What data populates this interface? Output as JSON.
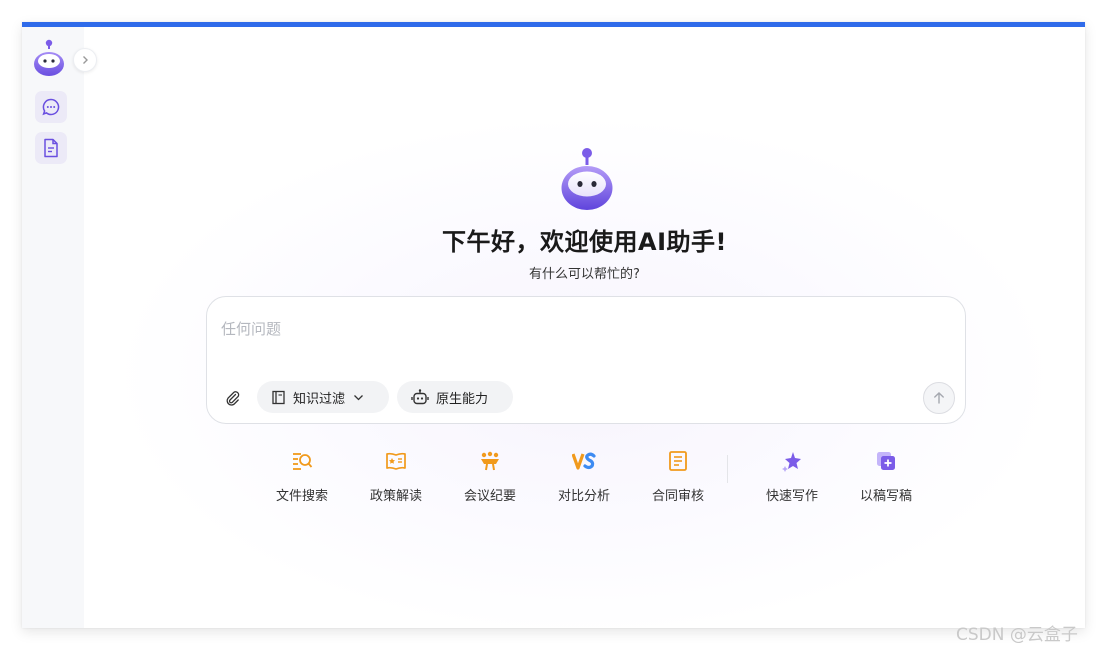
{
  "sidebar": {
    "logo_icon": "robot-mascot-icon",
    "expand_icon": "chevron-right-icon",
    "items": [
      {
        "icon": "chat-bubble-icon"
      },
      {
        "icon": "document-icon"
      }
    ]
  },
  "hero": {
    "greeting": "下午好，欢迎使用AI助手!",
    "subtitle": "有什么可以帮忙的?"
  },
  "composer": {
    "placeholder": "任何问题",
    "value": "",
    "knowledge_filter_label": "知识过滤",
    "native_ability_label": "原生能力"
  },
  "tools": [
    {
      "label": "文件搜索",
      "icon": "file-search-icon"
    },
    {
      "label": "政策解读",
      "icon": "policy-book-icon"
    },
    {
      "label": "会议纪要",
      "icon": "meeting-icon"
    },
    {
      "label": "对比分析",
      "icon": "vs-compare-icon"
    },
    {
      "label": "合同审核",
      "icon": "contract-icon"
    },
    {
      "label": "快速写作",
      "icon": "sparkle-write-icon"
    },
    {
      "label": "以稿写稿",
      "icon": "copy-add-icon"
    }
  ],
  "watermark": "CSDN @云盒子",
  "colors": {
    "accent_bar": "#2f6bea",
    "brand_purple": "#7b5ce8",
    "tool_orange": "#f19a1c"
  }
}
